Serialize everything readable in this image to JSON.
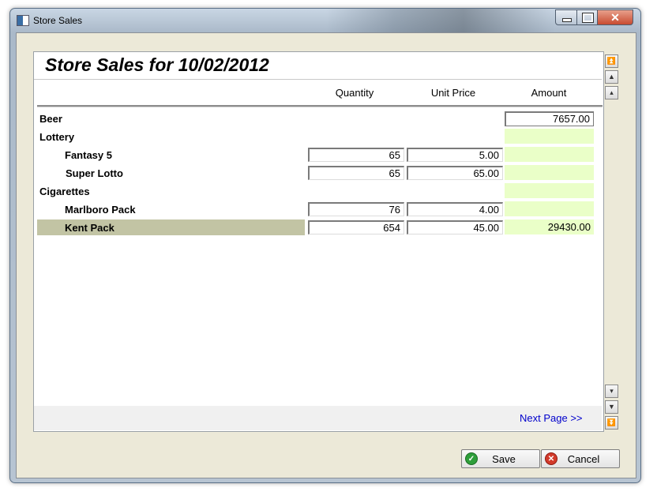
{
  "window": {
    "title": "Store Sales",
    "icons": {
      "app": "app-window-icon",
      "minimize": "minimize-icon",
      "maximize": "maximize-icon",
      "close": "close-icon"
    }
  },
  "page": {
    "title": "Store Sales for 10/02/2012"
  },
  "columns": {
    "quantity": "Quantity",
    "unit_price": "Unit Price",
    "amount": "Amount"
  },
  "rows": {
    "beer": {
      "label": "Beer",
      "amount": "7657.00"
    },
    "lottery": {
      "label": "Lottery"
    },
    "fantasy5": {
      "label": "Fantasy 5",
      "quantity": "65",
      "unit_price": "5.00"
    },
    "super_lotto": {
      "label": "Super Lotto",
      "quantity": "65",
      "unit_price": "65.00"
    },
    "cigarettes": {
      "label": "Cigarettes"
    },
    "marlboro": {
      "label": "Marlboro Pack",
      "quantity": "76",
      "unit_price": "4.00"
    },
    "kent": {
      "label": "Kent Pack",
      "quantity": "654",
      "unit_price": "45.00",
      "amount": "29430.00"
    }
  },
  "navigation": {
    "next_page": "Next Page >>"
  },
  "buttons": {
    "save": "Save",
    "cancel": "Cancel"
  },
  "colors": {
    "amount_bg": "#eaffc8",
    "selected_row": "#c2c4a4",
    "link": "#0000cc"
  }
}
